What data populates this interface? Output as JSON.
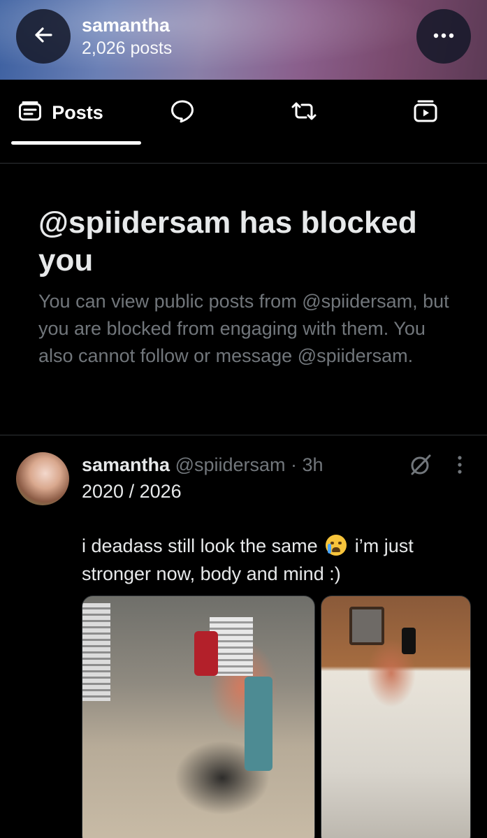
{
  "header": {
    "name": "samantha",
    "post_count": "2,026 posts"
  },
  "tabs": [
    {
      "label": "Posts",
      "icon": "posts-icon",
      "active": true
    },
    {
      "label": "",
      "icon": "reply-bubble-icon",
      "active": false
    },
    {
      "label": "",
      "icon": "repost-icon",
      "active": false
    },
    {
      "label": "",
      "icon": "media-icon",
      "active": false
    }
  ],
  "blocked": {
    "title": "@spiidersam has blocked you",
    "description": "You can view public posts from @spiidersam, but you are blocked from engaging with them. You also cannot follow or message @spiidersam."
  },
  "post": {
    "name": "samantha",
    "handle_time": "@spiidersam · 3h",
    "line2": "2020 / 2026",
    "text_before_emoji": "i deadass still look the same",
    "emoji": "crying-face",
    "text_after_emoji": "i’m just stronger now, body and mind :)"
  },
  "colors": {
    "background": "#000000",
    "text_primary": "#e7e9ea",
    "text_secondary": "#71767b",
    "divider": "#2f3336"
  }
}
